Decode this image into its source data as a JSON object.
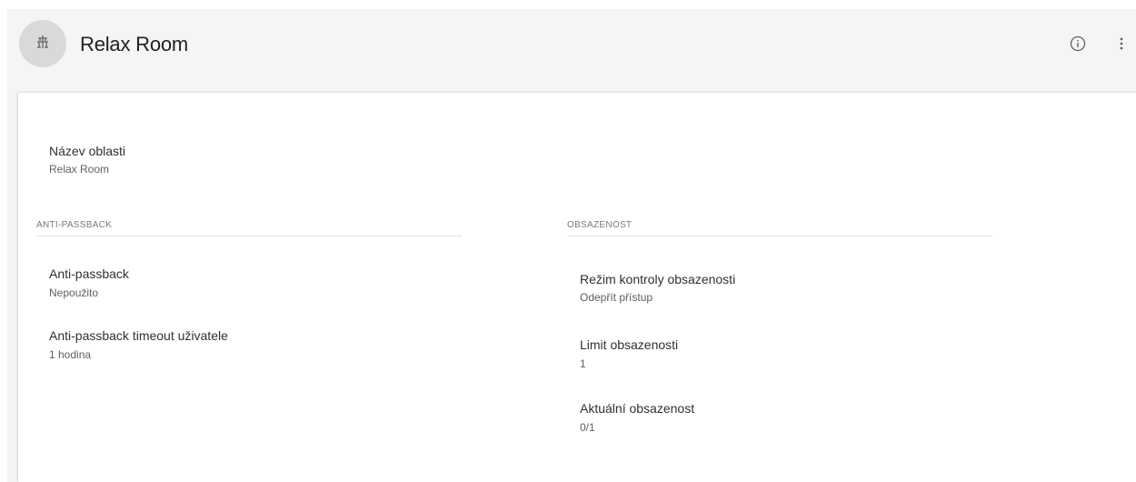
{
  "header": {
    "title": "Relax Room",
    "avatar_icon": "area-lock-icon",
    "info_icon": "info-icon",
    "menu_icon": "more-vert-icon"
  },
  "general": {
    "name_label": "Název oblasti",
    "name_value": "Relax Room"
  },
  "anti_passback": {
    "section_title": "ANTI-PASSBACK",
    "fields": [
      {
        "label": "Anti-passback",
        "value": "Nepoužito"
      },
      {
        "label": "Anti-passback timeout uživatele",
        "value": "1 hodina"
      }
    ]
  },
  "occupancy": {
    "section_title": "OBSAZENOST",
    "fields": [
      {
        "label": "Režim kontroly obsazenosti",
        "value": "Odepřít přístup"
      },
      {
        "label": "Limit obsazenosti",
        "value": "1"
      },
      {
        "label": "Aktuální obsazenost",
        "value": "0/1"
      }
    ]
  },
  "colors": {
    "background": "#f5f5f5",
    "card": "#ffffff",
    "avatar": "#d9d9d9",
    "icon": "#616161"
  }
}
